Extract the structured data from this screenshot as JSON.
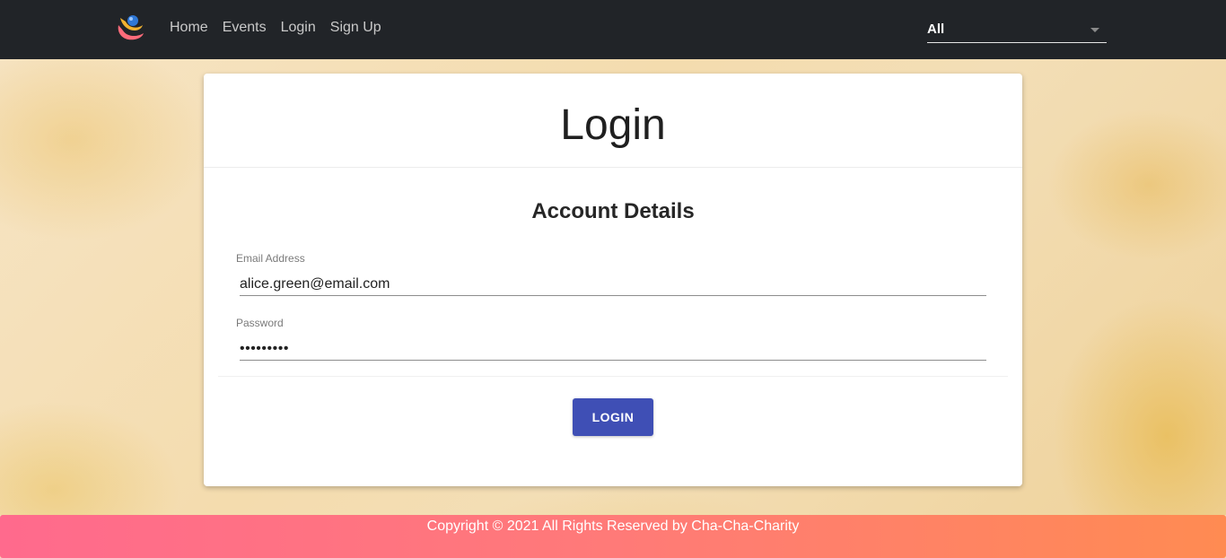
{
  "navbar": {
    "logo_icon": "charity-logo-icon",
    "links": [
      "Home",
      "Events",
      "Login",
      "Sign Up"
    ],
    "filter": {
      "value": "All"
    }
  },
  "card": {
    "title": "Login",
    "section_title": "Account Details",
    "email": {
      "label": "Email Address",
      "value": "alice.green@email.com"
    },
    "password": {
      "label": "Password",
      "value": "•••••••••"
    },
    "login_button": "LOGIN"
  },
  "footer": {
    "text": "Copyright © 2021 All Rights Reserved by Cha-Cha-Charity"
  },
  "colors": {
    "navbar_bg": "#212428",
    "button_bg": "#3f4fb5",
    "footer_gradient_start": "#ff6a8d",
    "footer_gradient_end": "#ff8b52"
  }
}
